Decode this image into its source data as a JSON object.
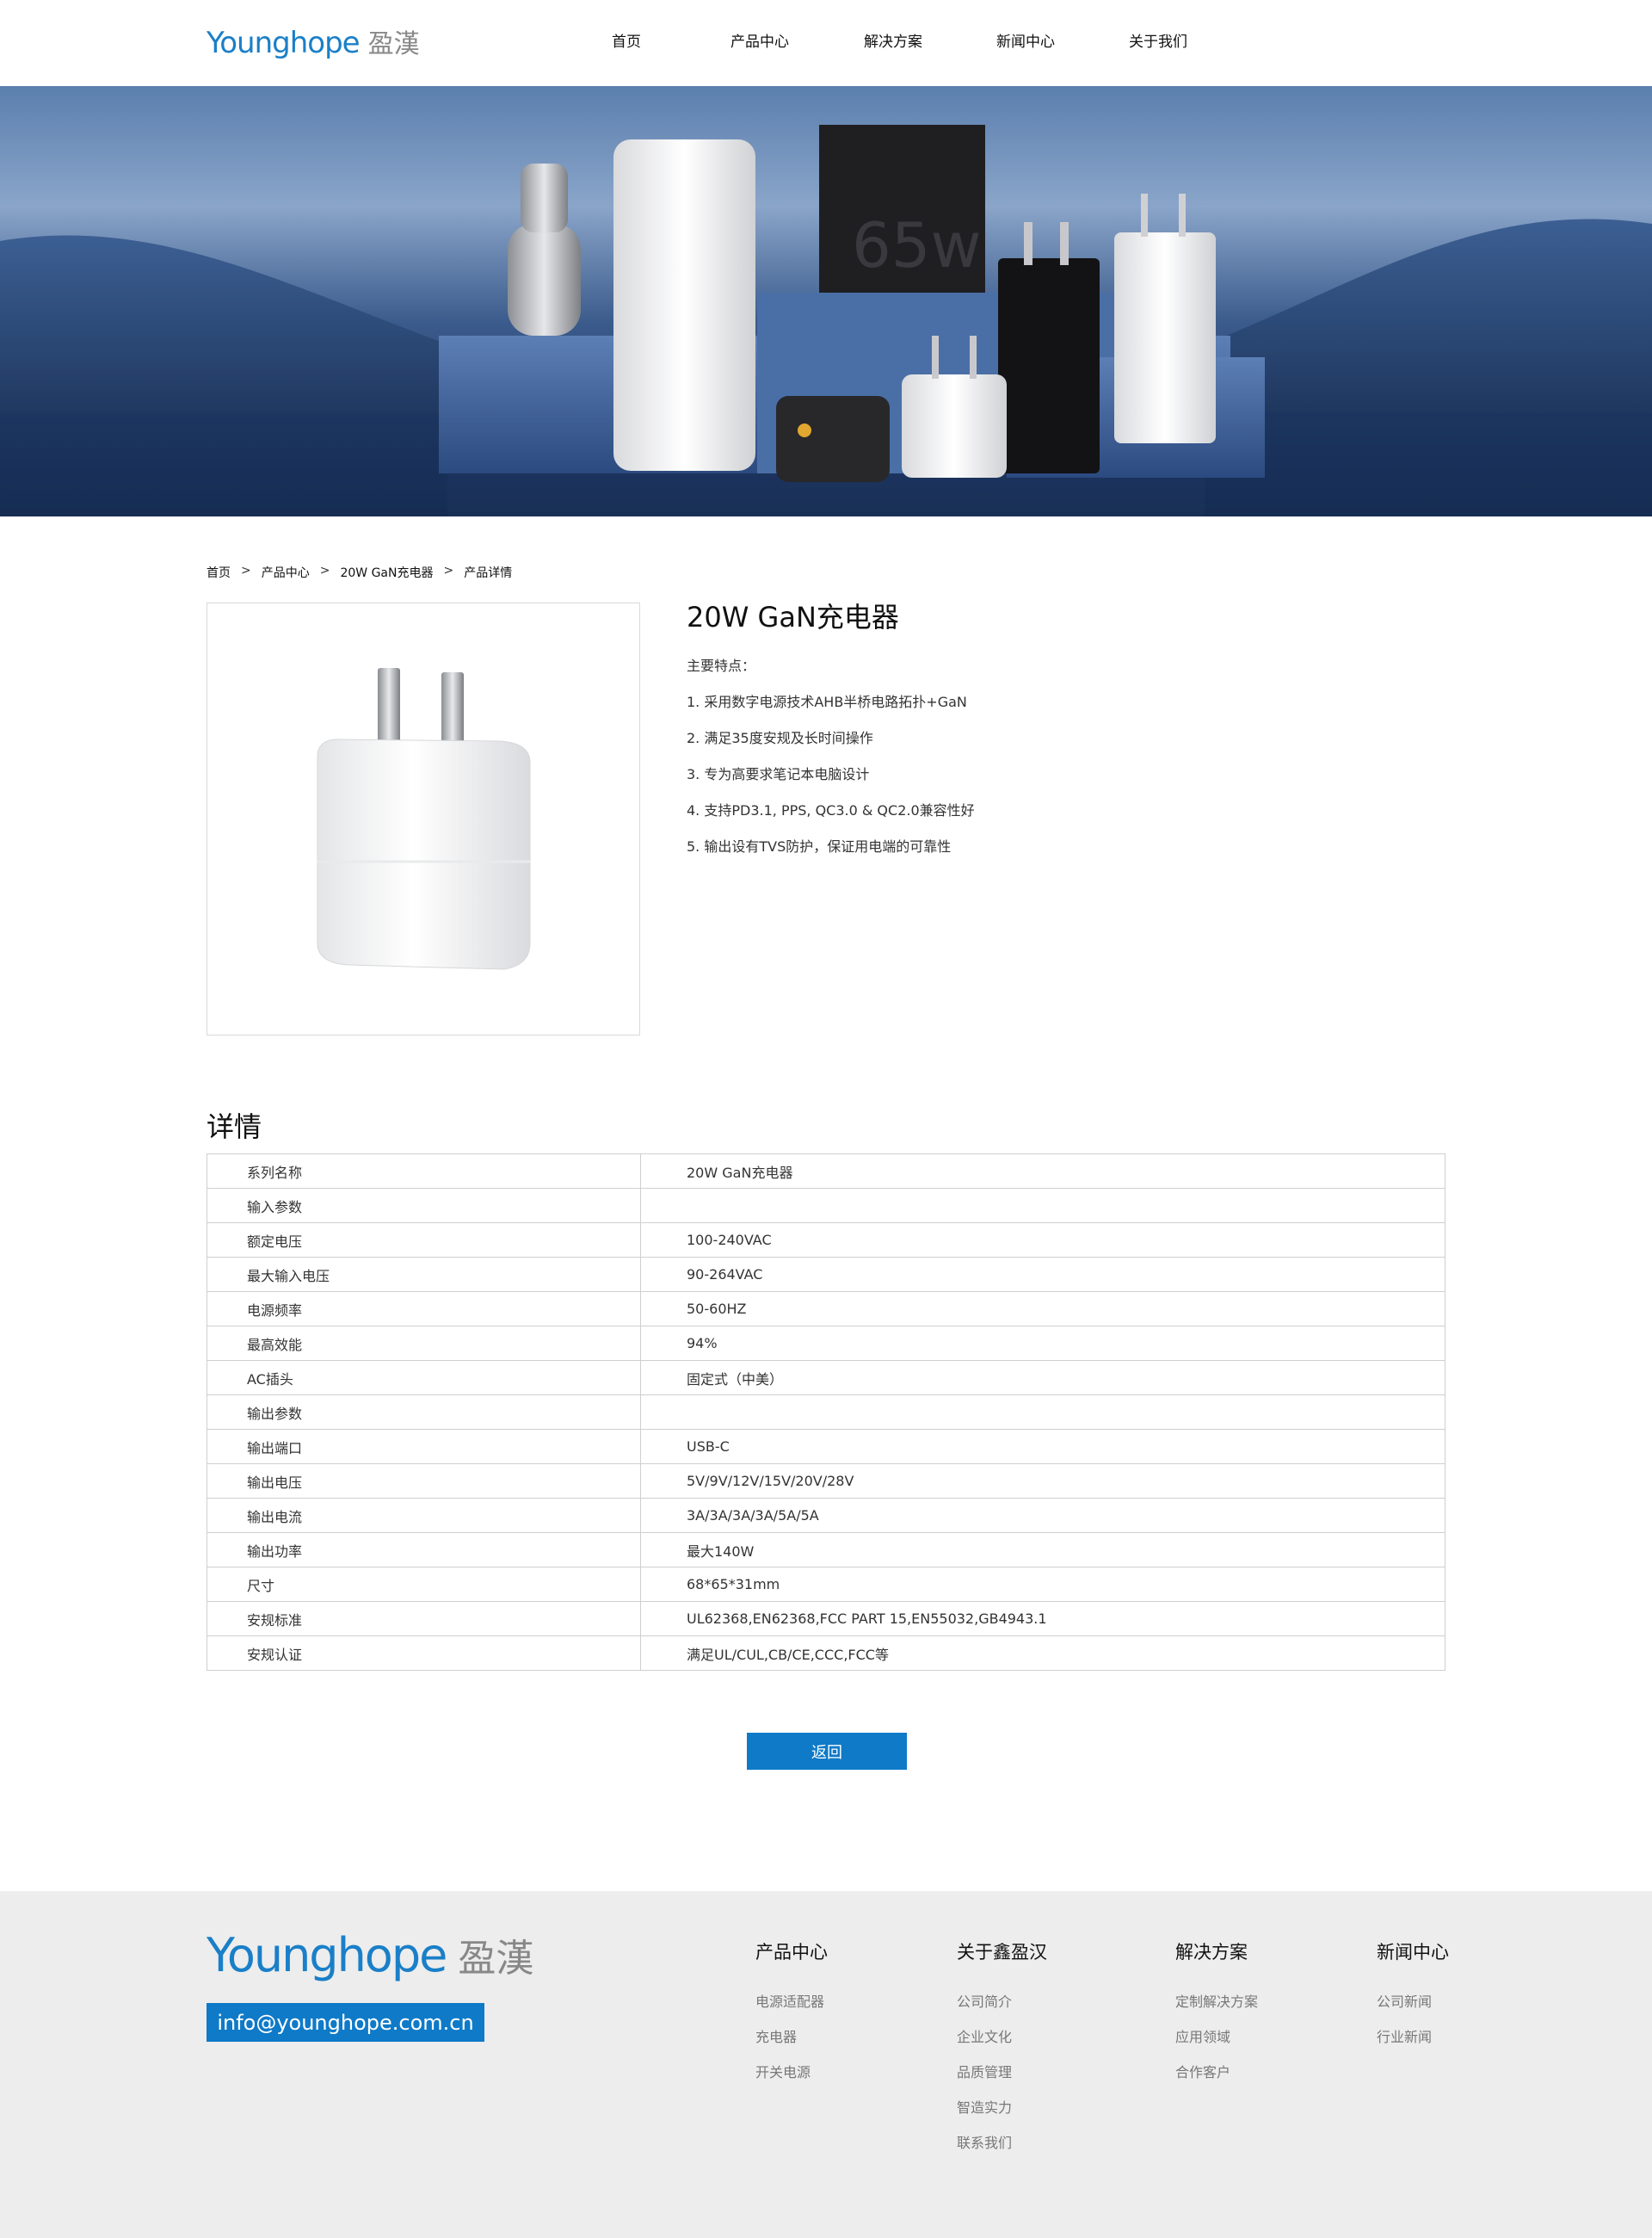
{
  "header": {
    "logo_en": "Younghope",
    "logo_cn": "盈漢",
    "nav": [
      "首页",
      "产品中心",
      "解决方案",
      "新闻中心",
      "关于我们"
    ]
  },
  "banner": {
    "badge_text": "65w"
  },
  "breadcrumb": [
    "首页",
    "产品中心",
    "20W GaN充电器",
    "产品详情"
  ],
  "breadcrumb_sep": ">",
  "product": {
    "title": "20W GaN充电器",
    "features_heading": "主要特点：",
    "features": [
      "1. 采用数字电源技术AHB半桥电路拓扑+GaN",
      "2. 满足35度安规及长时间操作",
      "3. 专为高要求笔记本电脑设计",
      "4. 支持PD3.1, PPS, QC3.0 & QC2.0兼容性好",
      "5. 输出设有TVS防护，保证用电端的可靠性"
    ]
  },
  "detail": {
    "title": "详情",
    "rows": [
      [
        "系列名称",
        "20W GaN充电器"
      ],
      [
        "输入参数",
        ""
      ],
      [
        "额定电压",
        "100-240VAC"
      ],
      [
        "最大输入电压",
        "90-264VAC"
      ],
      [
        "电源频率",
        "50-60HZ"
      ],
      [
        "最高效能",
        "94%"
      ],
      [
        "AC插头",
        "固定式（中美）"
      ],
      [
        "输出参数",
        ""
      ],
      [
        "输出端口",
        "USB-C"
      ],
      [
        "输出电压",
        "5V/9V/12V/15V/20V/28V"
      ],
      [
        "输出电流",
        "3A/3A/3A/3A/5A/5A"
      ],
      [
        "输出功率",
        "最大140W"
      ],
      [
        "尺寸",
        "68*65*31mm"
      ],
      [
        "安规标准",
        "UL62368,EN62368,FCC PART 15,EN55032,GB4943.1"
      ],
      [
        "安规认证",
        "满足UL/CUL,CB/CE,CCC,FCC等"
      ]
    ]
  },
  "back_button": "返回",
  "footer": {
    "logo_en": "Younghope",
    "logo_cn": "盈漢",
    "email": "info@younghope.com.cn",
    "columns": [
      {
        "title": "产品中心",
        "links": [
          "电源适配器",
          "充电器",
          "开关电源"
        ]
      },
      {
        "title": "关于鑫盈汉",
        "links": [
          "公司简介",
          "企业文化",
          "品质管理",
          "智造实力",
          "联系我们"
        ]
      },
      {
        "title": "解决方案",
        "links": [
          "定制解决方案",
          "应用领域",
          "合作客户"
        ]
      },
      {
        "title": "新闻中心",
        "links": [
          "公司新闻",
          "行业新闻"
        ]
      }
    ]
  },
  "colors": {
    "accent": "#0e7ac8",
    "footer_bg": "#ededed"
  }
}
